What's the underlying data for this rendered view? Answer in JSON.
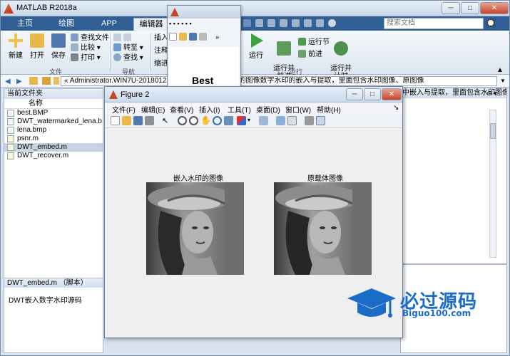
{
  "app": {
    "title": "MATLAB R2018a"
  },
  "tabs": [
    {
      "label": "主页"
    },
    {
      "label": "绘图"
    },
    {
      "label": "APP"
    },
    {
      "label": "编辑器"
    }
  ],
  "search": {
    "placeholder": "搜索文档"
  },
  "ribbon": {
    "new_label": "新建",
    "open_label": "打开",
    "save_label": "保存",
    "find_files_label": "查找文件",
    "compare_label": "比较",
    "print_label": "打印",
    "file_group": "文件",
    "insert_label": "插入",
    "comment_label": "注释",
    "indent_label": "缩进",
    "goto_label": "转至",
    "find_label": "查找",
    "nav_group": "导航",
    "run_label": "运行",
    "run_advance_label": "运行并\n前进",
    "run_section_label": "运行节",
    "advance_label": "前进",
    "run_time_label": "运行并\n计时",
    "run_group": "运行"
  },
  "address": {
    "path": "« Administrator.WIN7U-2018012 … AB程序：利用DWT的图像数字水印的嵌入与提取，里面包含水印图像、原图像"
  },
  "left_panel": {
    "header": "当前文件夹",
    "col_name": "名称",
    "files": [
      {
        "name": "best.BMP",
        "selected": false
      },
      {
        "name": "DWT_watermarked_lena.b",
        "selected": false
      },
      {
        "name": "lena.bmp",
        "selected": false
      },
      {
        "name": "psnr.m",
        "selected": false
      },
      {
        "name": "DWT_embed.m",
        "selected": true
      },
      {
        "name": "DWT_recover.m",
        "selected": false
      }
    ],
    "details_header": "DWT_embed.m （脚本）",
    "details_text": "DWT嵌入数字水印源码"
  },
  "editor": {
    "header": "中嵌入与提取，里面包含水印图像、原图像"
  },
  "small_figure": {
    "text": "Best"
  },
  "figure2": {
    "title": "Figure 2",
    "menu": [
      "文件(F)",
      "编辑(E)",
      "查看(V)",
      "插入(I)",
      "工具(T)",
      "桌面(D)",
      "窗口(W)",
      "帮助(H)"
    ],
    "left_title": "嵌入水印的图像",
    "right_title": "原载体图像"
  },
  "watermark": {
    "name": "必过源码",
    "url": "Biguo100.com"
  }
}
